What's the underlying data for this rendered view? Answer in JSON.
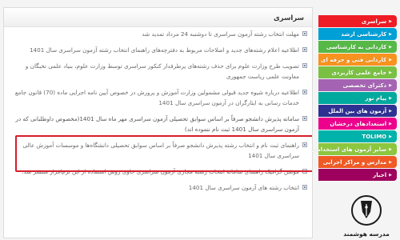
{
  "panel": {
    "title": "سراسری"
  },
  "news": [
    "مهلت انتخاب رشته آزمون سراسری تا دوشنبه 24 مرداد تمدید شد",
    "اطلاعیه اعلام رشته‌های جدید و اصلاحات مربوط به دفترچه‌های راهنمای انتخاب رشته آزمون سراسری سال 1401",
    "تصویب طرح وزارت علوم برای حذف رشته‌های پرطرفدار کنکور سراسری توسط وزارت علوم، بنیاد علمی نخبگان و معاونت علمی ریاست جمهوری",
    "اطلاعیه درباره شیوه جدید قبولی مشمولین وزارت آموزش و پرورش در خصوص آیین نامه اجرایی ماده (70) قانون جامع خدمات رسانی به ایثارگران در آزمون سراسری سال 1401",
    "سامانه پذیرش دانشجو صرفاً بر اساس سوابق تحصیلی آزمون سراسری مهر ماه سال 1401(مخصوص داوطلبانی که در آزمون سراسری سال 1401 ثبت نام ننموده اند)",
    "راهنمای ثبت نام و انتخاب رشته پذیرش دانشجو صرفاً بر اساس سوابق تحصیلی دانشگاه‌ها و موسسات آموزش عالی سراسری سال 1401",
    "موشن گرافیک راهنمای سامانه انتخاب رشته مجازی آزمون سراسری حاوی روش استفاده از این نرم‌افزار منتشر شد.",
    "انتخاب رشته های آزمون سراسری سال 1401"
  ],
  "menu": [
    {
      "label": "سراسری",
      "color": "#ee1c25"
    },
    {
      "label": "کارشناسی ارشد",
      "color": "#009fd6"
    },
    {
      "label": "کاردانی به کارشناسی",
      "color": "#56b947"
    },
    {
      "label": "کاردانی فنی و حرفه ای",
      "color": "#f7931e"
    },
    {
      "label": "جامع علمی کاربردی",
      "color": "#7ac143"
    },
    {
      "label": "دکترای تخصصی",
      "color": "#a564b3"
    },
    {
      "label": "پیام نور",
      "color": "#00a99d"
    },
    {
      "label": "آزمون های بین الملل",
      "color": "#2e3192"
    },
    {
      "label": "استعدادهای درخشان",
      "color": "#ec008c"
    },
    {
      "label": "TOLIMO",
      "color": "#00b2a9"
    },
    {
      "label": "سایر آزمون های استخدامی",
      "color": "#8dc63f"
    },
    {
      "label": "مدارس و مراکز اجرایی",
      "color": "#f15a24"
    },
    {
      "label": "اخبار",
      "color": "#9e005d"
    }
  ],
  "watermark": {
    "text": "مدرسه هوشمند"
  },
  "colors": {
    "highlight": "#d61e2b"
  }
}
